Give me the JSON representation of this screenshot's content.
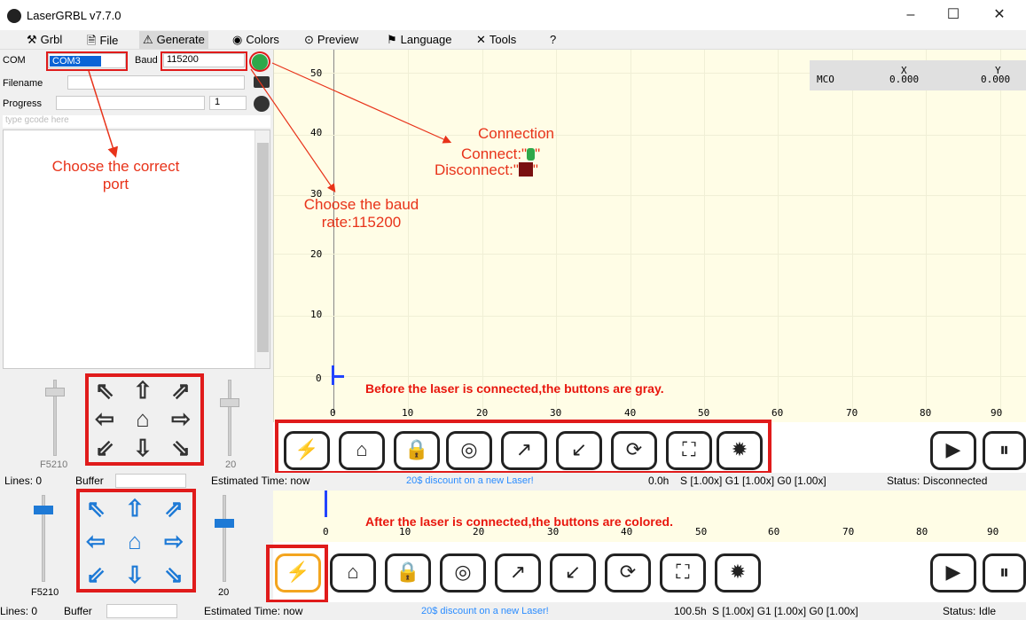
{
  "window": {
    "title": "LaserGRBL v7.7.0"
  },
  "menu": {
    "grbl": "Grbl",
    "file": "File",
    "generate": "Generate",
    "colors": "Colors",
    "preview": "Preview",
    "language": "Language",
    "tools": "Tools",
    "help": "?"
  },
  "connection": {
    "com_label": "COM",
    "com_value": "COM3",
    "baud_label": "Baud",
    "baud_value": "115200",
    "filename_label": "Filename",
    "progress_label": "Progress",
    "passes_value": "1",
    "gcode_placeholder": "type gcode here"
  },
  "sliders": {
    "left_top": "F5210",
    "right_top": "20",
    "left_bottom": "F5210",
    "right_bottom": "20"
  },
  "plot": {
    "y_ticks": [
      "50",
      "40",
      "30",
      "20",
      "10",
      "0"
    ],
    "x_ticks": [
      "0",
      "10",
      "20",
      "30",
      "40",
      "50",
      "60",
      "70",
      "80",
      "90"
    ],
    "mco_label": "MCO",
    "x_label": "X",
    "y_label": "Y",
    "x_value": "0.000",
    "y_value": "0.000"
  },
  "annotations": {
    "port": "Choose the correct port",
    "connection": "Connection",
    "connect": "Connect:\"",
    "disconnect": "Disconnect:\"",
    "quote": "\"",
    "baud": "Choose the baud rate:115200",
    "before": "Before the laser is connected,the buttons are gray.",
    "after": "After the laser is connected,the buttons are colored."
  },
  "status_top": {
    "lines": "Lines: 0",
    "buffer": "Buffer",
    "estimated": "Estimated Time: now",
    "promo": "20$ discount on a new Laser!",
    "time": "0.0h",
    "overrides": "S [1.00x]  G1 [1.00x]  G0 [1.00x]",
    "status": "Status: Disconnected"
  },
  "status_bottom": {
    "lines": "Lines: 0",
    "buffer": "Buffer",
    "estimated": "Estimated Time: now",
    "promo": "20$ discount on a new Laser!",
    "time": "100.5h",
    "overrides": "S [1.00x]  G1 [1.00x]  G0 [1.00x]",
    "status": "Status: Idle"
  },
  "colors": {
    "annotation": "#e8331a",
    "highlight_box": "#e01b1b",
    "active_blue": "#1e7ad6",
    "laser_orange": "#f3a51f",
    "plot_bg": "#fffde6"
  }
}
